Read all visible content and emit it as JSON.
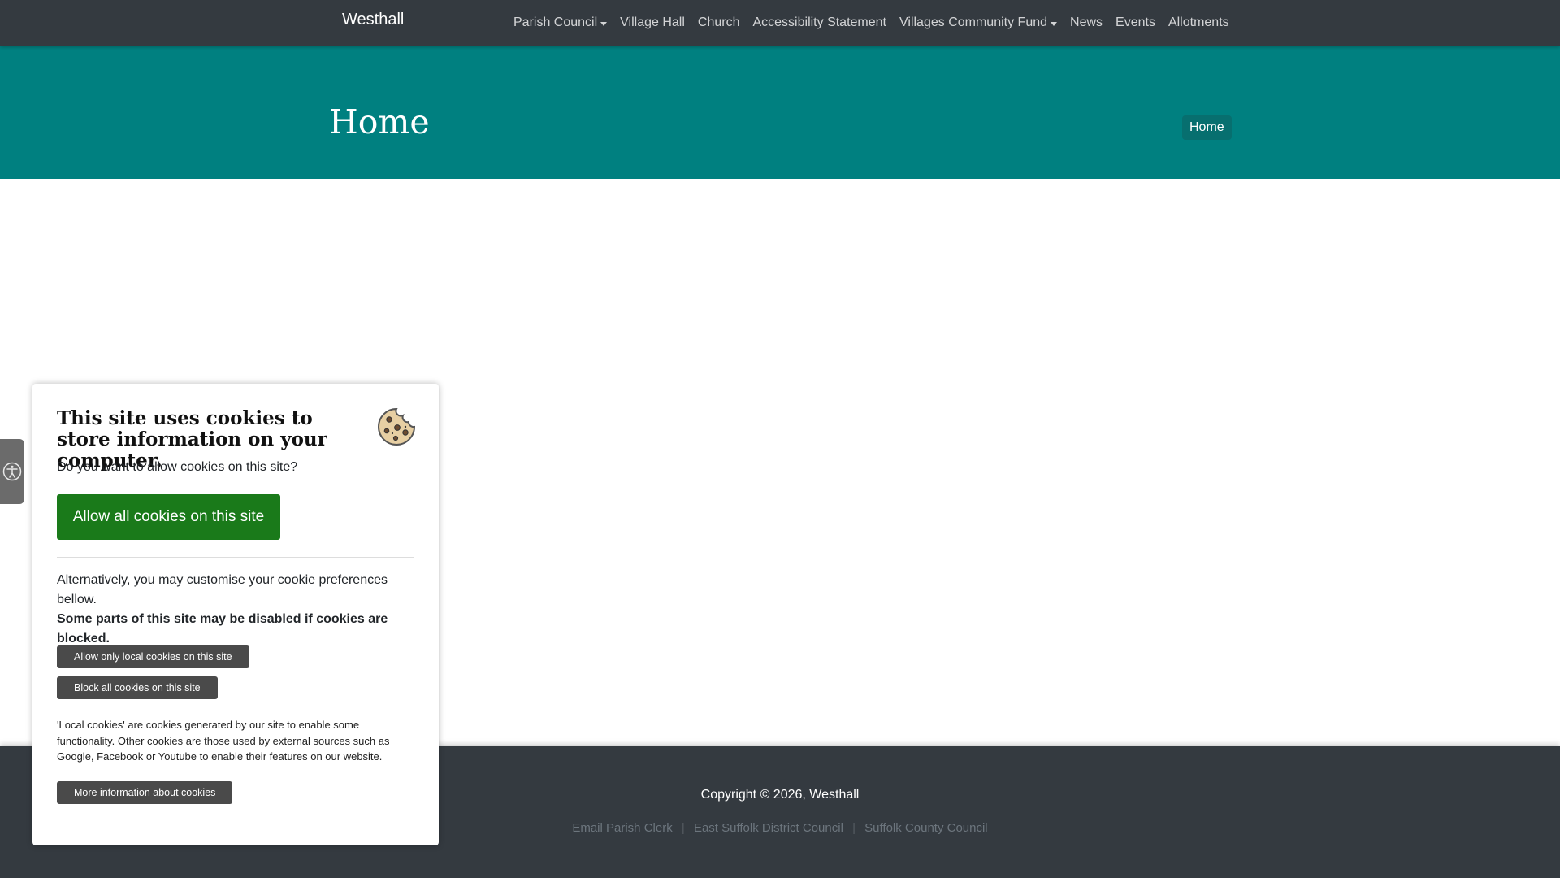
{
  "navbar": {
    "brand": "Westhall",
    "items": [
      {
        "label": "Parish Council",
        "dropdown": true
      },
      {
        "label": "Village Hall",
        "dropdown": false
      },
      {
        "label": "Church",
        "dropdown": false
      },
      {
        "label": "Accessibility Statement",
        "dropdown": false
      },
      {
        "label": "Villages Community Fund",
        "dropdown": true
      },
      {
        "label": "News",
        "dropdown": false
      },
      {
        "label": "Events",
        "dropdown": false
      },
      {
        "label": "Allotments",
        "dropdown": false
      }
    ]
  },
  "hero": {
    "title": "Home",
    "breadcrumb": "Home"
  },
  "footer": {
    "copyright": "Copyright © 2026, Westhall",
    "links": [
      "Email Parish Clerk",
      "East Suffolk District Council",
      "Suffolk County Council"
    ]
  },
  "accessibility_tab": {
    "icon": "accessibility-icon"
  },
  "cookie_banner": {
    "title": "This site uses cookies to store information on your computer.",
    "question": "Do you want to allow cookies on this site?",
    "allow_all_label": "Allow all cookies on this site",
    "alternative_text": "Alternatively, you may customise your cookie preferences bellow.",
    "warning_text": "Some parts of this site may be disabled if cookies are blocked.",
    "allow_local_label": "Allow only local cookies on this site",
    "block_all_label": "Block all cookies on this site",
    "note": "'Local cookies' are cookies generated by our site to enable some functionality. Other cookies are those used by external sources such as Google, Facebook or Youtube to enable their features on our website.",
    "more_info_label": "More information about cookies",
    "icon": "cookie-icon"
  },
  "colors": {
    "navbar": "#343a40",
    "hero": "#008080",
    "allow_button": "#1a7a1a",
    "secondary_button": "#4a4a4a"
  }
}
